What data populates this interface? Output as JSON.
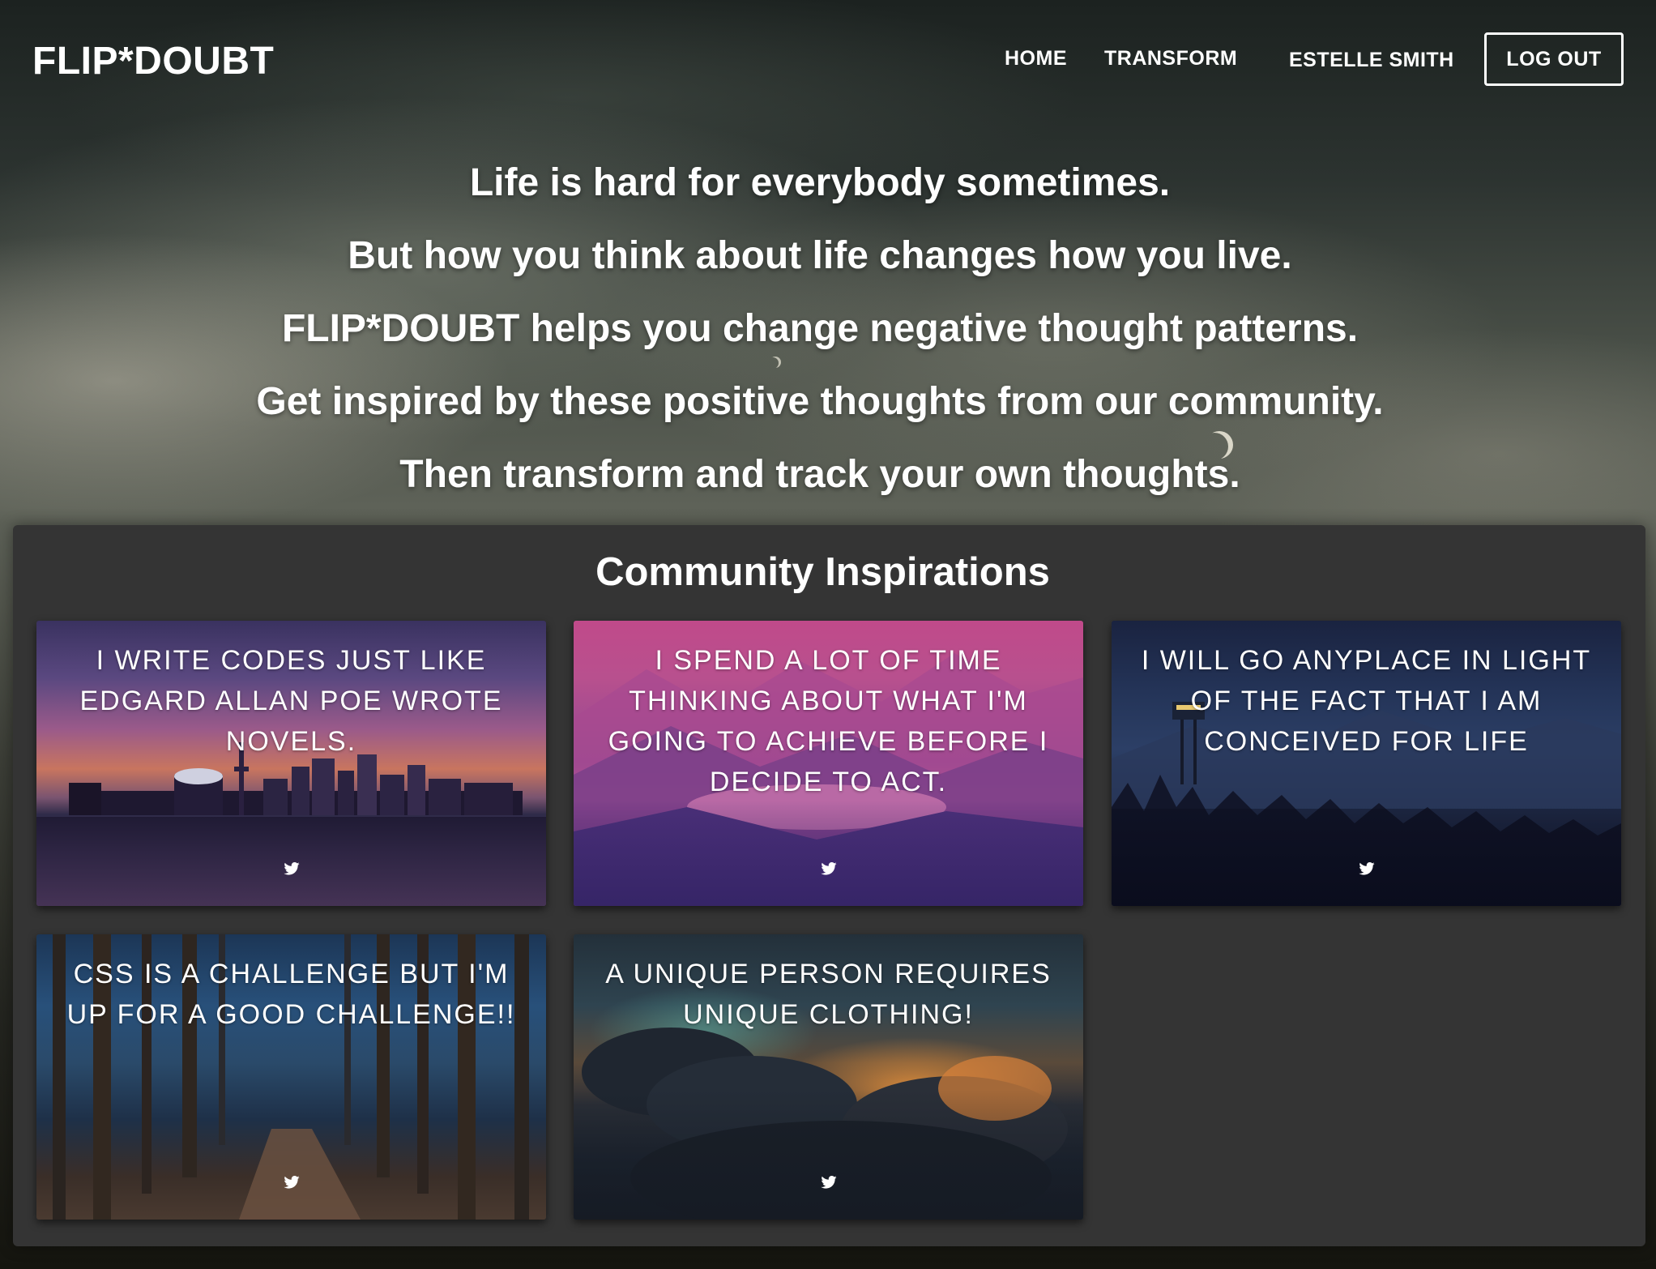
{
  "header": {
    "brand": "FLIP*DOUBT",
    "nav": {
      "home": "HOME",
      "transform": "TRANSFORM",
      "user": "ESTELLE SMITH",
      "logout": "LOG OUT"
    }
  },
  "hero": {
    "lines": [
      "Life is hard for everybody sometimes.",
      "But how you think about life changes how you live.",
      "FLIP*DOUBT helps you change negative thought patterns.",
      "Get inspired by these positive thoughts from our community.",
      "Then transform and track your own thoughts."
    ]
  },
  "community": {
    "title": "Community Inspirations",
    "cards": [
      {
        "text": "I WRITE CODES JUST LIKE EDGARD ALLAN POE WROTE NOVELS.",
        "icon": "twitter-icon"
      },
      {
        "text": "I SPEND A LOT OF TIME THINKING ABOUT WHAT I'M GOING TO ACHIEVE BEFORE I DECIDE TO ACT.",
        "icon": "twitter-icon"
      },
      {
        "text": "I WILL GO ANYPLACE IN LIGHT OF THE FACT THAT I AM CONCEIVED FOR LIFE",
        "icon": "twitter-icon"
      },
      {
        "text": "CSS IS A CHALLENGE BUT I'M UP FOR A GOOD CHALLENGE!!",
        "icon": "twitter-icon"
      },
      {
        "text": "A UNIQUE PERSON REQUIRES UNIQUE CLOTHING!",
        "icon": "twitter-icon"
      }
    ]
  },
  "colors": {
    "panel": "#343434",
    "text": "#ffffff"
  }
}
